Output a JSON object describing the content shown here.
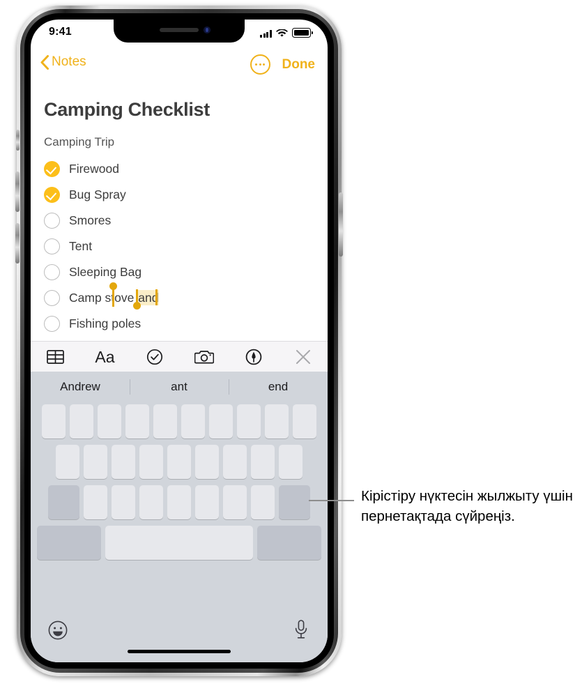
{
  "status_bar": {
    "time": "9:41",
    "signal_icon": "cellular-signal-icon",
    "wifi_icon": "wifi-icon",
    "battery_icon": "battery-icon"
  },
  "nav_bar": {
    "back_label": "Notes",
    "back_icon": "chevron-left-icon",
    "more_icon": "more-ellipsis-circle-icon",
    "done_label": "Done",
    "accent_color": "#f0b21b"
  },
  "note": {
    "title": "Camping Checklist",
    "subtitle": "Camping Trip",
    "items": [
      {
        "label": "Firewood",
        "checked": true
      },
      {
        "label": "Bug Spray",
        "checked": true
      },
      {
        "label": "Smores",
        "checked": false
      },
      {
        "label": "Tent",
        "checked": false
      },
      {
        "label": "Sleeping Bag",
        "checked": false
      },
      {
        "label": "Camp stove and",
        "checked": false,
        "selection": "and",
        "prefix": "Camp stove "
      },
      {
        "label": "Fishing poles",
        "checked": false
      }
    ],
    "checked_color": "#fcbf1a",
    "selection_handle_color": "#e3a70c",
    "selection_highlight_color": "#faeec8"
  },
  "format_toolbar": {
    "items": [
      {
        "name": "table-icon",
        "label": ""
      },
      {
        "name": "text-format-icon",
        "label": "Aa"
      },
      {
        "name": "checklist-icon",
        "label": ""
      },
      {
        "name": "camera-icon",
        "label": ""
      },
      {
        "name": "markup-pen-icon",
        "label": ""
      },
      {
        "name": "close-icon",
        "label": ""
      }
    ]
  },
  "keyboard": {
    "predictions": [
      "Andrew",
      "ant",
      "end"
    ],
    "row1_keys": 10,
    "row2_keys": 9,
    "row3_keys": 7,
    "emoji_icon": "emoji-smiley-icon",
    "mic_icon": "microphone-icon"
  },
  "callout": {
    "text": "Кірістіру нүктесін жылжыту үшін пернетақтада сүйреңіз."
  }
}
